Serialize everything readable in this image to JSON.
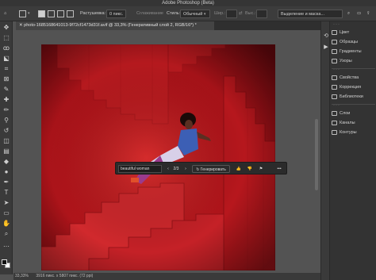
{
  "app": {
    "title": "Adobe Photoshop (Beta)"
  },
  "options": {
    "feather_label": "Растушевка:",
    "feather_value": "0 пикс.",
    "antialias_label": "Сглаживание",
    "style_label": "Стиль:",
    "style_value": "Обычный",
    "width_label": "Шир.:",
    "height_label": "Выс.:",
    "select_mask_label": "Выделение и маска..."
  },
  "document": {
    "tab_title": "photo-1685168641013-9f72cf1473d31f.avif @ 33,3% (Генеративный слой 2, RGB/16*) *"
  },
  "context_bar": {
    "prompt_value": "beautiful woman",
    "variation_counter": "2/3",
    "generate_label": "Генерировать",
    "prev_icon": "chevron-left-icon",
    "next_icon": "chevron-right-icon"
  },
  "status": {
    "zoom": "33,33%",
    "dimensions": "3916 пикс. x 5807 пикс. (72 ppi)"
  },
  "panels": [
    {
      "label": "Цвет",
      "icon": "color-icon"
    },
    {
      "label": "Образцы",
      "icon": "swatches-icon"
    },
    {
      "label": "Градиенты",
      "icon": "gradients-icon"
    },
    {
      "label": "Узоры",
      "icon": "patterns-icon"
    },
    {
      "label": "Свойства",
      "icon": "properties-icon"
    },
    {
      "label": "Коррекция",
      "icon": "adjustments-icon"
    },
    {
      "label": "Библиотеки",
      "icon": "libraries-icon"
    },
    {
      "label": "Слои",
      "icon": "layers-icon"
    },
    {
      "label": "Каналы",
      "icon": "channels-icon"
    },
    {
      "label": "Контуры",
      "icon": "paths-icon"
    }
  ],
  "colors": {
    "photo_red": "#b3151b",
    "stair_light": "#d83a3a",
    "stair_dark": "#8c0f14",
    "dress": "#4a6fc4"
  }
}
